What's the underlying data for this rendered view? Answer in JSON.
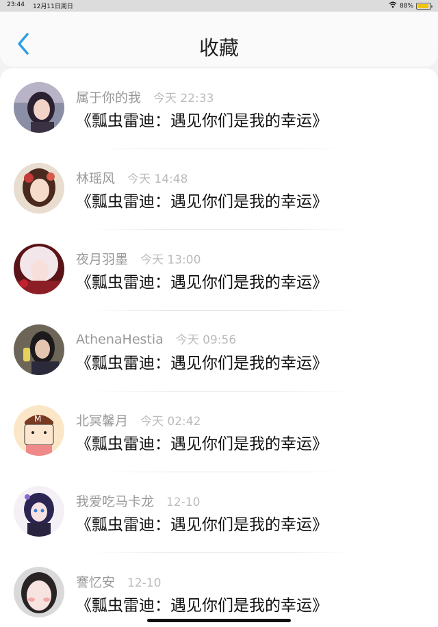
{
  "status_bar": {
    "time": "23:44",
    "date": "12月11日周日",
    "battery": "88%",
    "battery_level": 0.88
  },
  "header": {
    "title": "收藏"
  },
  "items": [
    {
      "user": "属于你的我",
      "time": "今天 22:33",
      "title": "《瓢虫雷迪：遇见你们是我的幸运》"
    },
    {
      "user": "林瑶风",
      "time": "今天 14:48",
      "title": "《瓢虫雷迪：遇见你们是我的幸运》"
    },
    {
      "user": "夜月羽墨",
      "time": "今天 13:00",
      "title": "《瓢虫雷迪：遇见你们是我的幸运》"
    },
    {
      "user": "AthenaHestia",
      "time": "今天 09:56",
      "title": "《瓢虫雷迪：遇见你们是我的幸运》"
    },
    {
      "user": "北冥馨月",
      "time": "今天 02:42",
      "title": "《瓢虫雷迪：遇见你们是我的幸运》"
    },
    {
      "user": "我爱吃马卡龙",
      "time": "12-10",
      "title": "《瓢虫雷迪：遇见你们是我的幸运》"
    },
    {
      "user": "謇忆安",
      "time": "12-10",
      "title": "《瓢虫雷迪：遇见你们是我的幸运》"
    }
  ]
}
